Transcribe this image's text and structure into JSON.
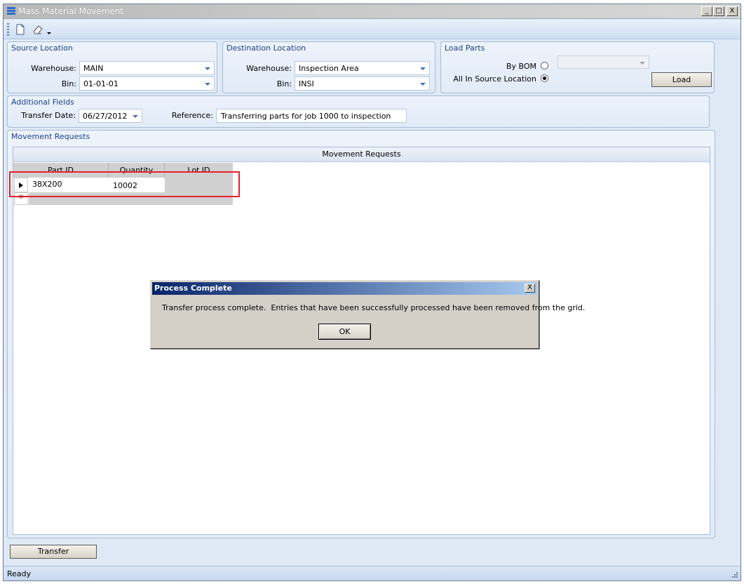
{
  "window": {
    "title": "Mass Material Movement",
    "minimize": "_",
    "maximize": "□",
    "close": "X"
  },
  "source": {
    "title": "Source Location",
    "warehouse_label": "Warehouse:",
    "warehouse_value": "MAIN",
    "bin_label": "Bin:",
    "bin_value": "01-01-01"
  },
  "destination": {
    "title": "Destination Location",
    "warehouse_label": "Warehouse:",
    "warehouse_value": "Inspection Area",
    "bin_label": "Bin:",
    "bin_value": "INSI"
  },
  "load_parts": {
    "title": "Load Parts",
    "by_bom_label": "By BOM",
    "all_in_source_label": "All In Source Location",
    "load_button": "Load"
  },
  "additional": {
    "title": "Additional Fields",
    "transfer_date_label": "Transfer Date:",
    "transfer_date_value": "06/27/2012",
    "reference_label": "Reference:",
    "reference_value": "Transferring parts for job 1000 to inspection"
  },
  "movement": {
    "title": "Movement Requests",
    "grid_caption": "Movement Requests",
    "columns": [
      "Part ID",
      "Quantity",
      "Lot ID"
    ],
    "rows": [
      {
        "part_id": "38X200",
        "quantity": "10002",
        "lot_id": ""
      }
    ],
    "new_row_marker": "*"
  },
  "transfer_button": "Transfer",
  "status": "Ready",
  "dialog": {
    "title": "Process Complete",
    "message": "Transfer process complete.  Entries that have been successfully processed have been removed from the grid.",
    "ok": "OK",
    "close": "X"
  },
  "colors": {
    "group_title": "#1a3f8a",
    "highlight": "#e8202a",
    "dialog_title": "#0a246a"
  }
}
